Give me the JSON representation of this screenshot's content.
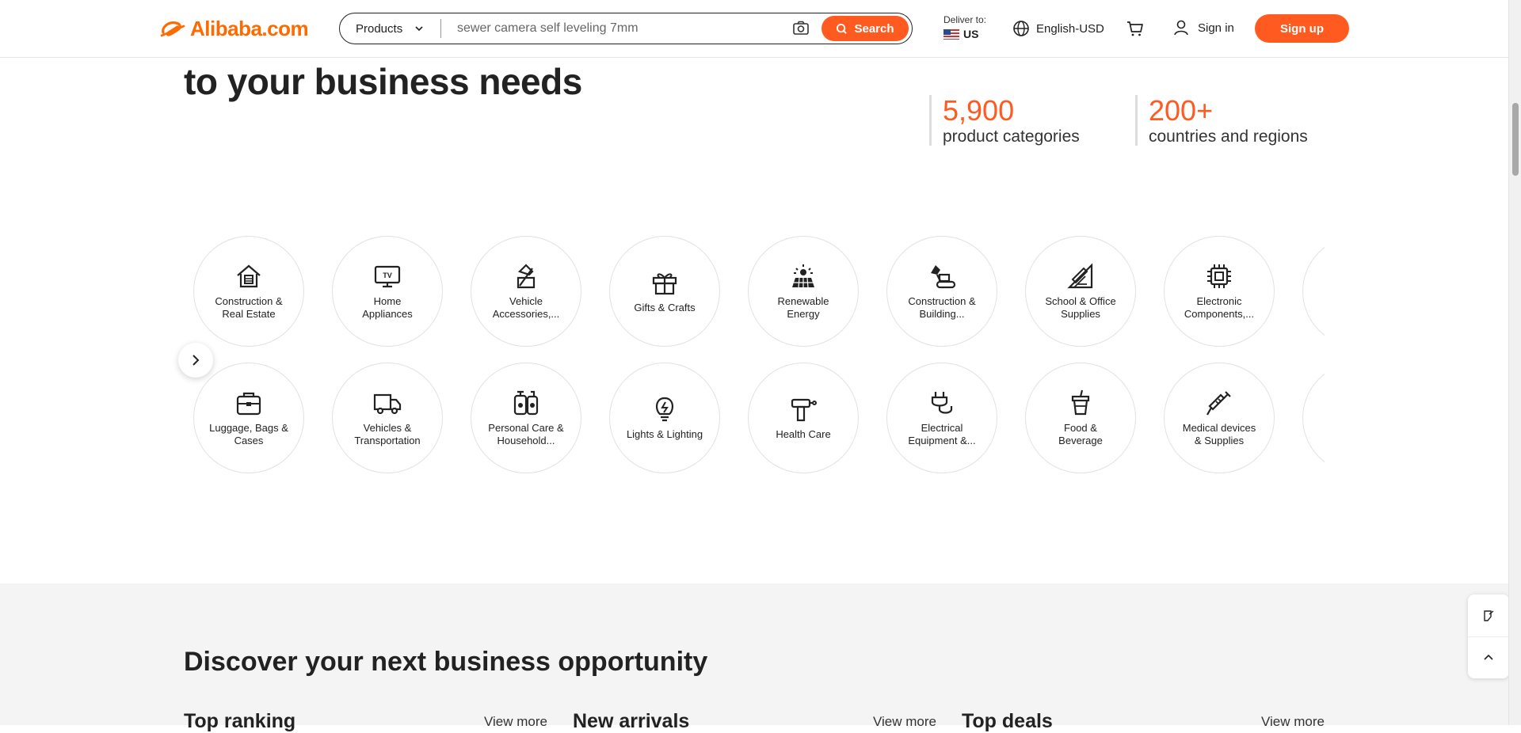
{
  "header": {
    "logo_text": "Alibaba.com",
    "products_label": "Products",
    "search_value": "sewer camera self leveling 7mm",
    "search_button": "Search",
    "deliver_label": "Deliver to:",
    "deliver_country": "US",
    "language": "English-USD",
    "sign_in": "Sign in",
    "sign_up": "Sign up"
  },
  "hero": {
    "title": "to your business needs",
    "stats": [
      {
        "number": "5,900",
        "label": "product categories"
      },
      {
        "number": "200+",
        "label": "countries and regions"
      }
    ]
  },
  "categories": {
    "row1": [
      {
        "label": "Construction & Real Estate",
        "icon": "house-icon"
      },
      {
        "label": "Home Appliances",
        "icon": "tv-icon"
      },
      {
        "label": "Vehicle Accessories,...",
        "icon": "vehicle-accessory-icon"
      },
      {
        "label": "Gifts & Crafts",
        "icon": "gift-icon"
      },
      {
        "label": "Renewable Energy",
        "icon": "solar-panel-icon"
      },
      {
        "label": "Construction & Building...",
        "icon": "excavator-icon"
      },
      {
        "label": "School & Office Supplies",
        "icon": "ruler-pencil-icon"
      },
      {
        "label": "Electronic Components,...",
        "icon": "chip-icon"
      },
      {
        "label": "",
        "icon": ""
      }
    ],
    "row2": [
      {
        "label": "Luggage, Bags & Cases",
        "icon": "bag-icon"
      },
      {
        "label": "Vehicles & Transportation",
        "icon": "truck-icon"
      },
      {
        "label": "Personal Care & Household...",
        "icon": "bottles-icon"
      },
      {
        "label": "Lights & Lighting",
        "icon": "bulb-icon"
      },
      {
        "label": "Health Care",
        "icon": "massage-gun-icon"
      },
      {
        "label": "Electrical Equipment &...",
        "icon": "plug-icon"
      },
      {
        "label": "Food & Beverage",
        "icon": "cup-icon"
      },
      {
        "label": "Medical devices & Supplies",
        "icon": "syringe-icon"
      },
      {
        "label": "",
        "icon": ""
      }
    ]
  },
  "discover": {
    "title": "Discover your next business opportunity",
    "sections": [
      {
        "title": "Top ranking",
        "view_more": "View more"
      },
      {
        "title": "New arrivals",
        "view_more": "View more"
      },
      {
        "title": "Top deals",
        "view_more": "View more"
      }
    ]
  },
  "colors": {
    "accent": "#ff5a1f",
    "brand": "#ff6a00"
  }
}
